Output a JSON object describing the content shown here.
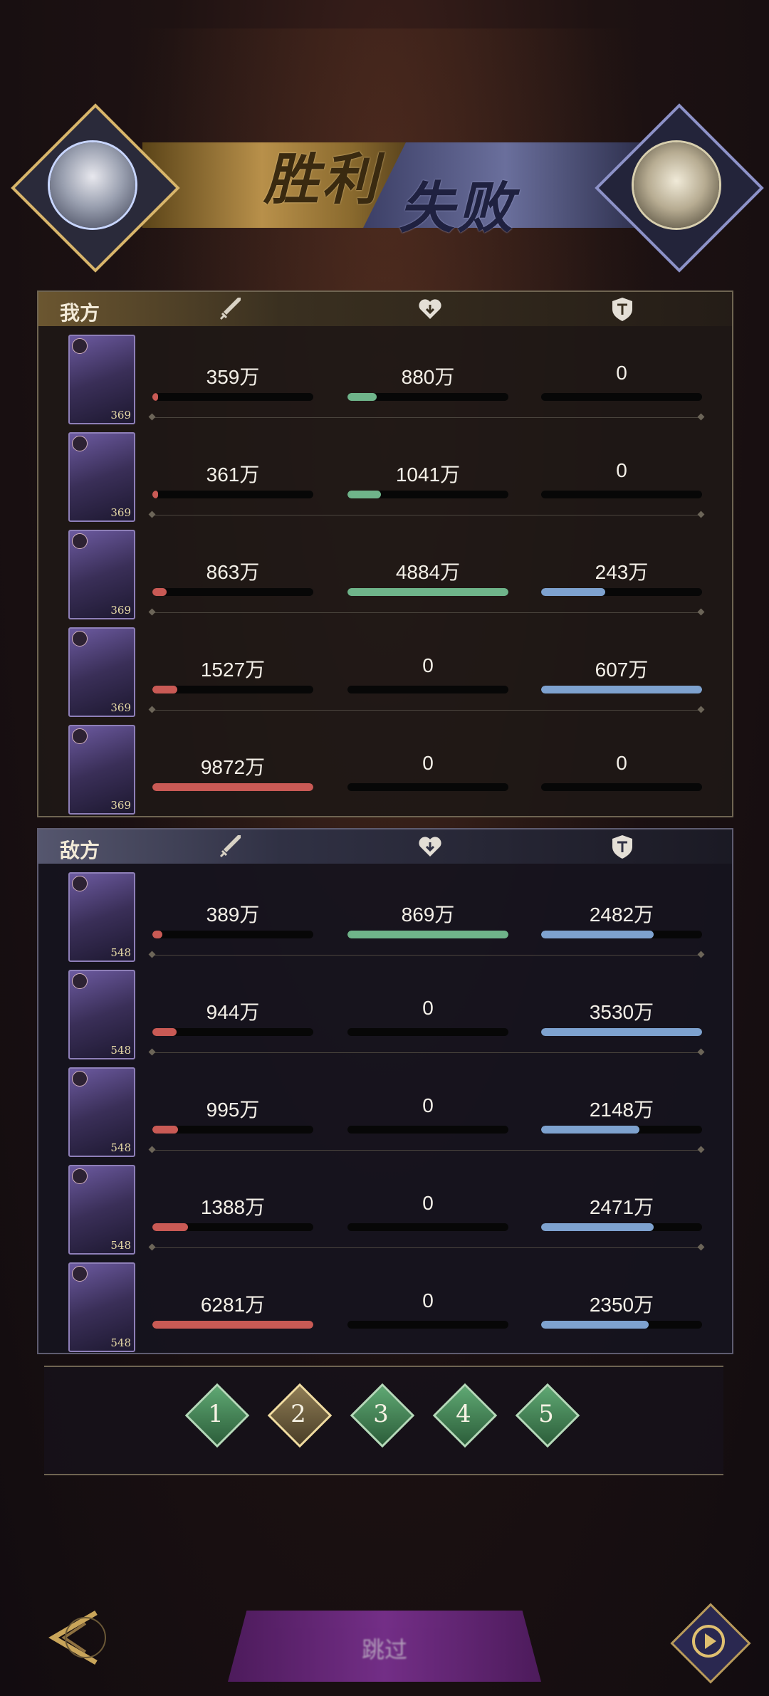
{
  "header": {
    "win_text": "胜利",
    "lose_text": "失败"
  },
  "colors": {
    "damage": "#c95a55",
    "heal": "#6fb48a",
    "shield": "#7ea2cf"
  },
  "icons": {
    "attack": "sword-icon",
    "heal": "heart-icon",
    "defense": "shield-icon"
  },
  "ours": {
    "title": "我方",
    "rows": [
      {
        "level": "369",
        "damage": "359万",
        "damage_pct": 0.036,
        "heal": "880万",
        "heal_pct": 0.18,
        "shield": "0",
        "shield_pct": 0
      },
      {
        "level": "369",
        "damage": "361万",
        "damage_pct": 0.037,
        "heal": "1041万",
        "heal_pct": 0.21,
        "shield": "0",
        "shield_pct": 0
      },
      {
        "level": "369",
        "damage": "863万",
        "damage_pct": 0.087,
        "heal": "4884万",
        "heal_pct": 1.0,
        "shield": "243万",
        "shield_pct": 0.4
      },
      {
        "level": "369",
        "damage": "1527万",
        "damage_pct": 0.155,
        "heal": "0",
        "heal_pct": 0,
        "shield": "607万",
        "shield_pct": 1.0
      },
      {
        "level": "369",
        "damage": "9872万",
        "damage_pct": 1.0,
        "heal": "0",
        "heal_pct": 0,
        "shield": "0",
        "shield_pct": 0
      }
    ]
  },
  "enemy": {
    "title": "敌方",
    "rows": [
      {
        "level": "548",
        "damage": "389万",
        "damage_pct": 0.062,
        "heal": "869万",
        "heal_pct": 1.0,
        "shield": "2482万",
        "shield_pct": 0.7
      },
      {
        "level": "548",
        "damage": "944万",
        "damage_pct": 0.15,
        "heal": "0",
        "heal_pct": 0,
        "shield": "3530万",
        "shield_pct": 1.0
      },
      {
        "level": "548",
        "damage": "995万",
        "damage_pct": 0.158,
        "heal": "0",
        "heal_pct": 0,
        "shield": "2148万",
        "shield_pct": 0.61
      },
      {
        "level": "548",
        "damage": "1388万",
        "damage_pct": 0.221,
        "heal": "0",
        "heal_pct": 0,
        "shield": "2471万",
        "shield_pct": 0.7
      },
      {
        "level": "548",
        "damage": "6281万",
        "damage_pct": 1.0,
        "heal": "0",
        "heal_pct": 0,
        "shield": "2350万",
        "shield_pct": 0.67
      }
    ]
  },
  "pager": {
    "pages": [
      "1",
      "2",
      "3",
      "4",
      "5"
    ],
    "active_index": 1
  },
  "footer": {
    "skip_label": "跳过"
  }
}
